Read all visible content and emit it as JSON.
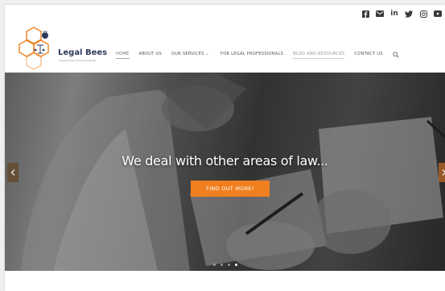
{
  "brand": {
    "name": "Legal Bees",
    "tagline": "Supporting law schools & students",
    "colors": {
      "accent": "#f0801f",
      "navy": "#2e3a5c"
    }
  },
  "social": [
    {
      "name": "facebook-icon",
      "glyph": "f"
    },
    {
      "name": "email-icon",
      "glyph": "✉"
    },
    {
      "name": "linkedin-icon",
      "glyph": "in"
    },
    {
      "name": "twitter-icon",
      "glyph": "t"
    },
    {
      "name": "instagram-icon",
      "glyph": "◎"
    },
    {
      "name": "youtube-icon",
      "glyph": "▶"
    }
  ],
  "nav": {
    "items": [
      {
        "label": "HOME"
      },
      {
        "label": "ABOUT US"
      },
      {
        "label": "OUR SERVICES ⌄"
      },
      {
        "label": "FOR LEGAL PROFESSIONALS"
      },
      {
        "label": "BLOG AND RESOURCES"
      },
      {
        "label": "CONTACT US"
      }
    ],
    "search_icon": "search-icon"
  },
  "hero": {
    "title": "We deal with other areas of law...",
    "button_label": "FIND OUT MORE!",
    "prev_icon": "chevron-left-icon",
    "next_icon": "chevron-right-icon",
    "slide_count": 4,
    "active_slide": 4
  }
}
